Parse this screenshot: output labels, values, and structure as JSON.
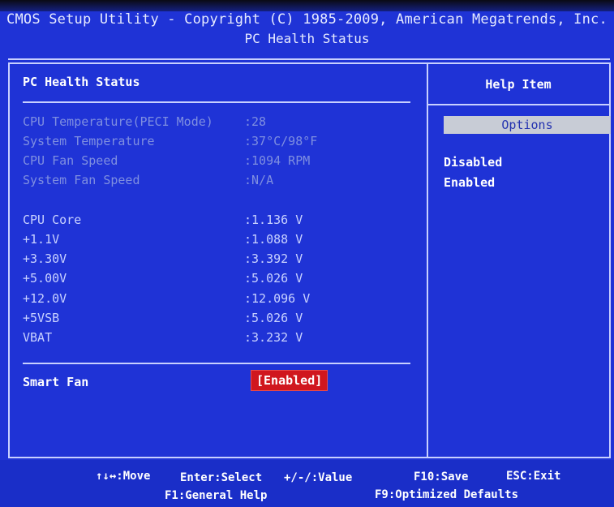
{
  "header": {
    "title_line_1": "CMOS Setup Utility - Copyright (C) 1985-2009, American Megatrends, Inc.",
    "title_line_2": "PC Health Status"
  },
  "left_panel": {
    "title": "PC Health Status",
    "status_rows": [
      {
        "label": "CPU Temperature(PECI Mode)",
        "value": ":28"
      },
      {
        "label": "System Temperature",
        "value": ":37°C/98°F"
      },
      {
        "label": "CPU Fan Speed",
        "value": ":1094 RPM"
      },
      {
        "label": "System Fan Speed",
        "value": ":N/A"
      }
    ],
    "voltage_rows": [
      {
        "label": "CPU Core",
        "value": ":1.136 V"
      },
      {
        "label": "+1.1V",
        "value": ":1.088 V"
      },
      {
        "label": "+3.30V",
        "value": ":3.392 V"
      },
      {
        "label": "+5.00V",
        "value": ":5.026 V"
      },
      {
        "label": "+12.0V",
        "value": ":12.096 V"
      },
      {
        "label": "+5VSB",
        "value": ":5.026 V"
      },
      {
        "label": "VBAT",
        "value": ":3.232 V"
      }
    ],
    "smart_fan": {
      "label": "Smart Fan",
      "value": "[Enabled]"
    }
  },
  "right_panel": {
    "title": "Help Item",
    "options_header": "Options",
    "options": [
      "Disabled",
      "Enabled"
    ]
  },
  "footer": {
    "move": "↑↓↔:Move",
    "select": "Enter:Select",
    "value": "+/-/:Value",
    "save": "F10:Save",
    "exit": "ESC:Exit",
    "help": "F1:General Help",
    "defaults": "F9:Optimized Defaults"
  },
  "colors": {
    "background": "#1f33d6",
    "dim_text": "#7f8fe0",
    "highlight": "#d0171e"
  }
}
